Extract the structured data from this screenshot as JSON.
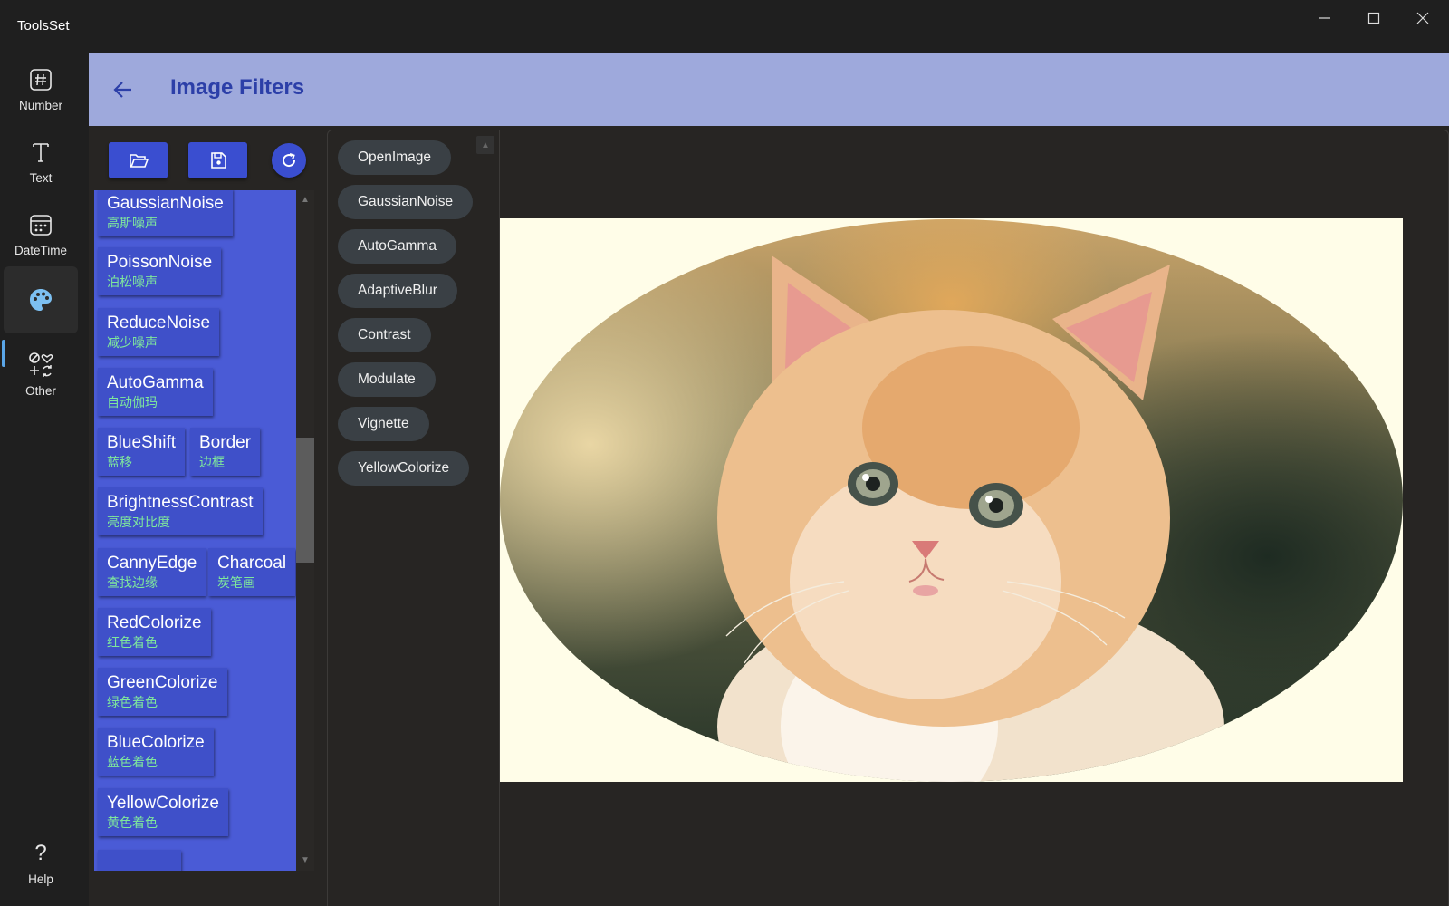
{
  "app": {
    "title": "ToolsSet"
  },
  "nav": {
    "items": [
      {
        "label": "Number",
        "icon": "hash-icon"
      },
      {
        "label": "Text",
        "icon": "text-icon"
      },
      {
        "label": "DateTime",
        "icon": "calendar-icon"
      },
      {
        "label": "",
        "icon": "palette-icon",
        "active": true
      },
      {
        "label": "Other",
        "icon": "shapes-icon"
      }
    ],
    "help_label": "Help"
  },
  "header": {
    "title": "Image Filters"
  },
  "toolbar": {
    "open": "folder-open-icon",
    "save": "save-icon",
    "reset": "refresh-icon"
  },
  "filters": [
    {
      "en": "GaussianNoise",
      "zh": "高斯噪声"
    },
    {
      "en": "PoissonNoise",
      "zh": "泊松噪声"
    },
    {
      "en": "ReduceNoise",
      "zh": "减少噪声"
    },
    {
      "en": "AutoGamma",
      "zh": "自动伽玛"
    },
    {
      "en": "BlueShift",
      "zh": "蓝移"
    },
    {
      "en": "Border",
      "zh": "边框"
    },
    {
      "en": "BrightnessContrast",
      "zh": "亮度对比度"
    },
    {
      "en": "CannyEdge",
      "zh": "查找边缘"
    },
    {
      "en": "Charcoal",
      "zh": "炭笔画"
    },
    {
      "en": "RedColorize",
      "zh": "红色着色"
    },
    {
      "en": "GreenColorize",
      "zh": "绿色着色"
    },
    {
      "en": "BlueColorize",
      "zh": "蓝色着色"
    },
    {
      "en": "YellowColorize",
      "zh": "黄色着色"
    }
  ],
  "pipeline": [
    "OpenImage",
    "GaussianNoise",
    "AutoGamma",
    "AdaptiveBlur",
    "Contrast",
    "Modulate",
    "Vignette",
    "YellowColorize"
  ],
  "colors": {
    "header_bg": "#9ea9dc",
    "title": "#2c3fa8",
    "accent": "#3a4ed0",
    "filter_panel": "#4a5bd6",
    "zh_text": "#7fe89c"
  }
}
